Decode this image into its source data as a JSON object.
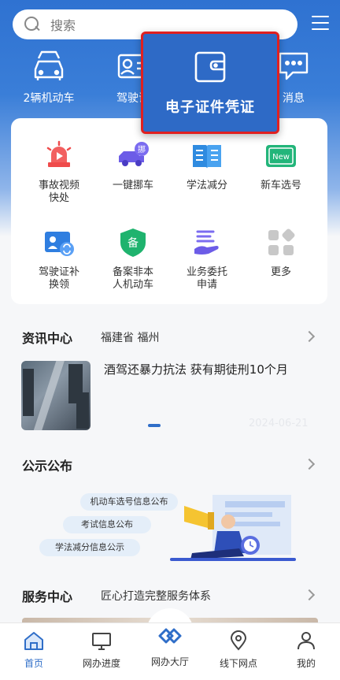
{
  "search": {
    "placeholder": "搜索"
  },
  "top_nav": {
    "items": [
      {
        "label": "2辆机动车",
        "icon": "car-stack-icon"
      },
      {
        "label": "驾驶证",
        "icon": "license-card-icon"
      },
      {
        "label": "消息",
        "icon": "message-icon"
      }
    ]
  },
  "popup": {
    "label": "电子证件凭证",
    "icon": "wallet-icon"
  },
  "services": [
    {
      "label_line1": "事故视频",
      "label_line2": "快处",
      "icon": "siren-video-icon"
    },
    {
      "label_line1": "一键挪车",
      "label_line2": "",
      "icon": "move-car-icon"
    },
    {
      "label_line1": "学法减分",
      "label_line2": "",
      "icon": "book-icon"
    },
    {
      "label_line1": "新车选号",
      "label_line2": "",
      "icon": "new-plate-icon"
    },
    {
      "label_line1": "驾驶证补",
      "label_line2": "换领",
      "icon": "license-renew-icon"
    },
    {
      "label_line1": "备案非本",
      "label_line2": "人机动车",
      "icon": "shield-record-icon"
    },
    {
      "label_line1": "业务委托",
      "label_line2": "申请",
      "icon": "delegate-icon"
    },
    {
      "label_line1": "更多",
      "label_line2": "",
      "icon": "more-grid-icon"
    }
  ],
  "news": {
    "title": "资讯中心",
    "location": "福建省 福州",
    "headline": "酒驾还暴力抗法 获有期徒刑10个月",
    "date": "2024-06-21"
  },
  "notice": {
    "title": "公示公布",
    "pills": [
      "机动车选号信息公布",
      "考试信息公布",
      "学法减分信息公示"
    ]
  },
  "service_center": {
    "title": "服务中心",
    "subtitle": "匠心打造完整服务体系"
  },
  "tabbar": {
    "items": [
      {
        "label": "首页",
        "icon": "home-icon",
        "active": true
      },
      {
        "label": "网办进度",
        "icon": "monitor-icon",
        "active": false
      },
      {
        "label": "网办大厅",
        "icon": "handshake-icon",
        "active": false
      },
      {
        "label": "线下网点",
        "icon": "location-icon",
        "active": false
      },
      {
        "label": "我的",
        "icon": "user-icon",
        "active": false
      }
    ]
  },
  "colors": {
    "brand_blue": "#2f6ec8",
    "highlight_border": "#e02020"
  }
}
